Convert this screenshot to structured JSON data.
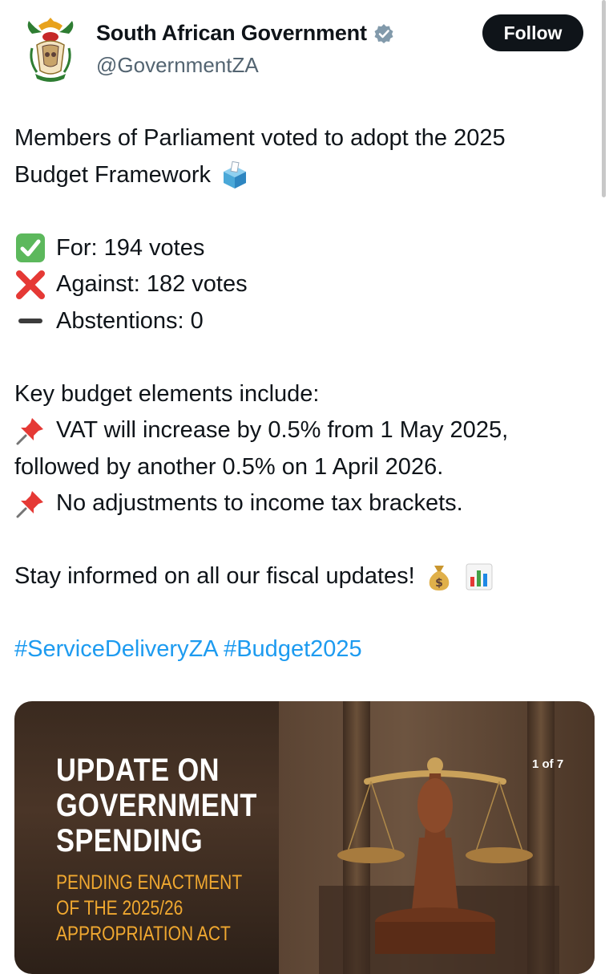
{
  "account": {
    "display_name": "South African Government",
    "handle": "@GovernmentZA",
    "verified_icon": "verified-badge-icon",
    "avatar": "coat-of-arms-logo"
  },
  "actions": {
    "follow_label": "Follow"
  },
  "post": {
    "line1": "Members of Parliament voted to adopt the 2025",
    "line2": "Budget Framework",
    "for_votes": "For: 194 votes",
    "against_votes": "Against: 182 votes",
    "abstentions": "Abstentions: 0",
    "key_intro": "Key budget elements include:",
    "vat_line1": "VAT will increase by 0.5% from 1 May 2025,",
    "vat_line2": "followed by another 0.5% on 1 April 2026.",
    "no_adjust": "No adjustments to income tax brackets.",
    "stay_informed": "Stay informed on all our fiscal updates!",
    "hashtags": "#ServiceDeliveryZA #Budget2025"
  },
  "media": {
    "title_line1": "UPDATE ON",
    "title_line2": "GOVERNMENT",
    "title_line3": "SPENDING",
    "sub_line1": "PENDING ENACTMENT",
    "sub_line2": "OF THE 2025/26",
    "sub_line3": "APPROPRIATION ACT",
    "counter": "1 of 7"
  },
  "colors": {
    "link": "#1d9bf0",
    "verified": "#829aab",
    "follow_bg": "#0f1419",
    "media_subtitle": "#f0a830"
  },
  "icons": [
    "ballot-box-icon",
    "check-mark-button-icon",
    "cross-mark-icon",
    "minus-icon",
    "pushpin-icon",
    "money-bag-icon",
    "bar-chart-icon"
  ]
}
